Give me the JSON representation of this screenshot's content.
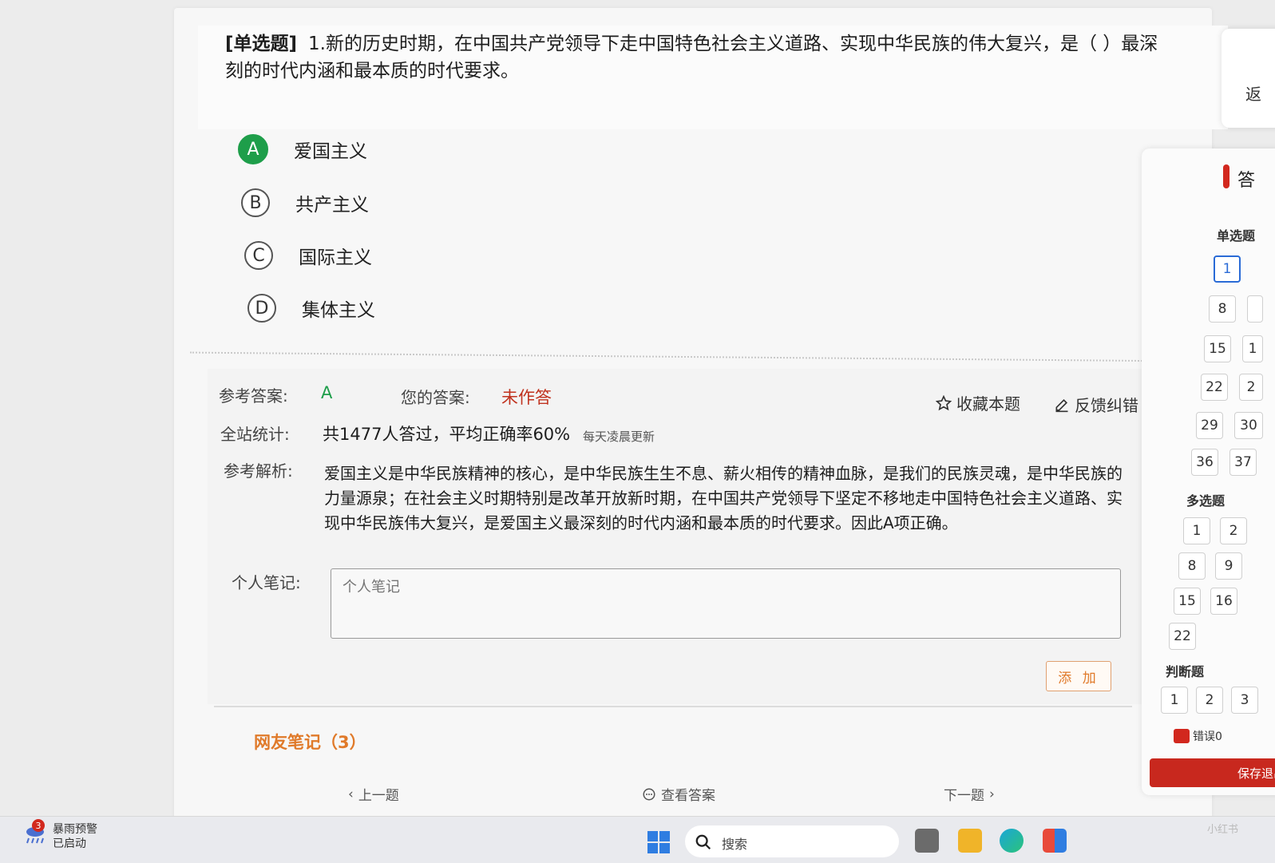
{
  "question": {
    "type_label": "[单选题]",
    "text": "1.新的历史时期，在中国共产党领导下走中国特色社会主义道路、实现中华民族的伟大复兴，是（   ）最深刻的时代内涵和最本质的时代要求。",
    "options": [
      {
        "letter": "A",
        "text": "爱国主义",
        "correct": true
      },
      {
        "letter": "B",
        "text": "共产主义",
        "correct": false
      },
      {
        "letter": "C",
        "text": "国际主义",
        "correct": false
      },
      {
        "letter": "D",
        "text": "集体主义",
        "correct": false
      }
    ]
  },
  "answer": {
    "ref_label": "参考答案:",
    "ref_value": "A",
    "your_label": "您的答案:",
    "your_value": "未作答",
    "favorite_label": "收藏本题",
    "feedback_label": "反馈纠错",
    "stats_label": "全站统计:",
    "stats_value": "共1477人答过，平均正确率60%",
    "stats_note": "每天凌晨更新",
    "analysis_label": "参考解析:",
    "analysis_text": "爱国主义是中华民族精神的核心，是中华民族生生不息、薪火相传的精神血脉，是我们的民族灵魂，是中华民族的力量源泉；在社会主义时期特别是改革开放新时期，在中国共产党领导下坚定不移地走中国特色社会主义道路、实现中华民族伟大复兴，是爱国主义最深刻的时代内涵和最本质的时代要求。因此A项正确。",
    "note_label": "个人笔记:",
    "note_placeholder": "个人笔记",
    "add_label": "添 加"
  },
  "netnotes": {
    "label": "网友笔记（3）"
  },
  "nav": {
    "prev": "上一题",
    "view": "查看答案",
    "next": "下一题"
  },
  "sidebar": {
    "top_partial": "返",
    "title": "答",
    "sections": [
      {
        "name": "单选题",
        "numbers": [
          "1",
          "8",
          "15",
          "22",
          "29",
          "36"
        ],
        "partial": [
          "",
          "",
          "1",
          "2",
          "30",
          "37"
        ]
      },
      {
        "name": "多选题",
        "numbers": [
          "1",
          "8",
          "15",
          "22"
        ],
        "second": [
          "2",
          "9",
          "16",
          ""
        ]
      },
      {
        "name": "判断题",
        "numbers": [
          "1",
          "2",
          "3"
        ]
      }
    ],
    "wrong_label": "错误0",
    "save_label": "保存退出"
  },
  "taskbar": {
    "weather_badge": "3",
    "weather_title": "暴雨预警",
    "weather_sub": "已启动",
    "search_label": "搜索",
    "watermark": "小红书"
  }
}
